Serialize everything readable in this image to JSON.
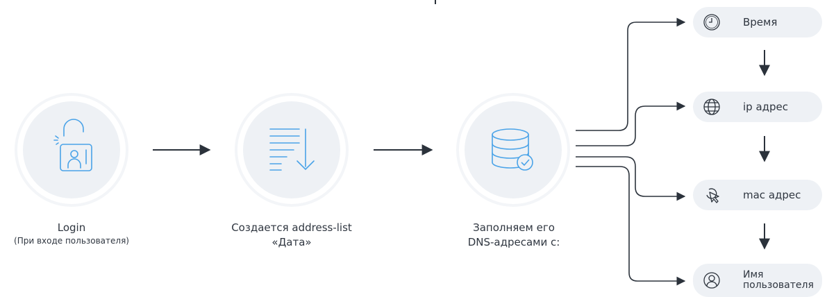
{
  "steps": [
    {
      "label": "Login",
      "sublabel": "(При входе пользователя)",
      "icon": "padlock-user-icon"
    },
    {
      "label": "Создается address-list",
      "sublabel": "«Дата»",
      "icon": "list-download-icon"
    },
    {
      "label": "Заполняем его",
      "sublabel": "DNS-адресами с:",
      "icon": "database-check-icon"
    }
  ],
  "sources": [
    {
      "label": "Время",
      "icon": "clock-icon"
    },
    {
      "label": "ip адрес",
      "icon": "globe-icon"
    },
    {
      "label": "mac адрес",
      "icon": "cursor-click-icon"
    },
    {
      "label": "Имя",
      "label2": "пользователя",
      "icon": "user-icon"
    }
  ],
  "colors": {
    "circle_fill": "#eef1f5",
    "circle_ring": "#f3f5f8",
    "icon_stroke": "#4aa3e8",
    "arrow": "#2b323b",
    "pill_fill": "#eef1f5"
  }
}
